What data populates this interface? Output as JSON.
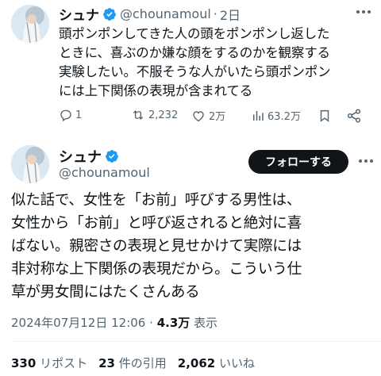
{
  "tweet1": {
    "display_name": "シュナ",
    "handle": "@chounamoul",
    "separator": "·",
    "time": "2日",
    "lines": [
      "頭ポンポンしてきた人の頭をポンポンし返した",
      "ときに、喜ぶのか嫌な顔をするのかを観察する",
      "実験したい。不服そうな人がいたら頭ポンポン",
      "には上下関係の表現が含まれてる"
    ],
    "actions": {
      "replies": "1",
      "reposts": "2,232",
      "likes": "2万",
      "views": "63.2万"
    }
  },
  "tweet2": {
    "display_name": "シュナ",
    "handle": "@chounamoul",
    "follow_label": "フォローする",
    "lines": [
      "似た話で、女性を「お前」呼びする男性は、",
      "女性から「お前」と呼び返されると絶対に喜",
      "ばない。親密さの表現と見せかけて実際には",
      "非対称な上下関係の表現だから。こういう仕",
      "草が男女間にはたくさんある"
    ],
    "meta": {
      "datetime": "2024年07月12日 12:06",
      "separator": "·",
      "views_count": "4.3万",
      "views_label": "表示"
    },
    "stats": {
      "reposts_count": "330",
      "reposts_label": "リポスト",
      "quotes_count": "23",
      "quotes_label": "件の引用",
      "likes_count": "2,062",
      "likes_label": "いいね"
    }
  },
  "colors": {
    "verified_badge": "#1d9bf0",
    "secondary_text": "#536471",
    "follow_button_bg": "#0f1419"
  },
  "icons": [
    "verified-badge-icon",
    "more-icon",
    "reply-icon",
    "repost-icon",
    "like-icon",
    "views-icon",
    "bookmark-icon",
    "share-icon"
  ]
}
